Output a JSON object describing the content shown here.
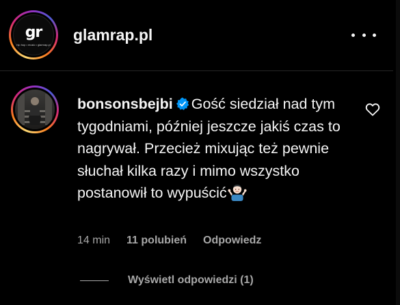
{
  "header": {
    "account_name": "glamrap.pl",
    "logo_text": "gr",
    "logo_subtext": "hip hop • music • glamrap.pl",
    "more_icon": "more-horizontal-icon"
  },
  "comment": {
    "username": "bonsonsbejbi",
    "verified_icon": "verified-badge-icon",
    "text": "Gość siedział nad tym tygodniami, później jeszcze jakiś czas to nagrywał. Przecież mixując też pewnie słuchał kilka razy i mimo wszystko postanowił to wypuścić",
    "emoji": "person-shrugging-emoji",
    "time": "14 min",
    "likes": "11 polubień",
    "reply_label": "Odpowiedz",
    "like_icon": "heart-outline-icon"
  },
  "replies": {
    "view_label": "Wyświetl odpowiedzi (1)"
  },
  "colors": {
    "background": "#000000",
    "text_primary": "#f5f5f5",
    "text_secondary": "#a8a8a8",
    "verified_blue": "#0095f6",
    "divider": "#262626"
  }
}
